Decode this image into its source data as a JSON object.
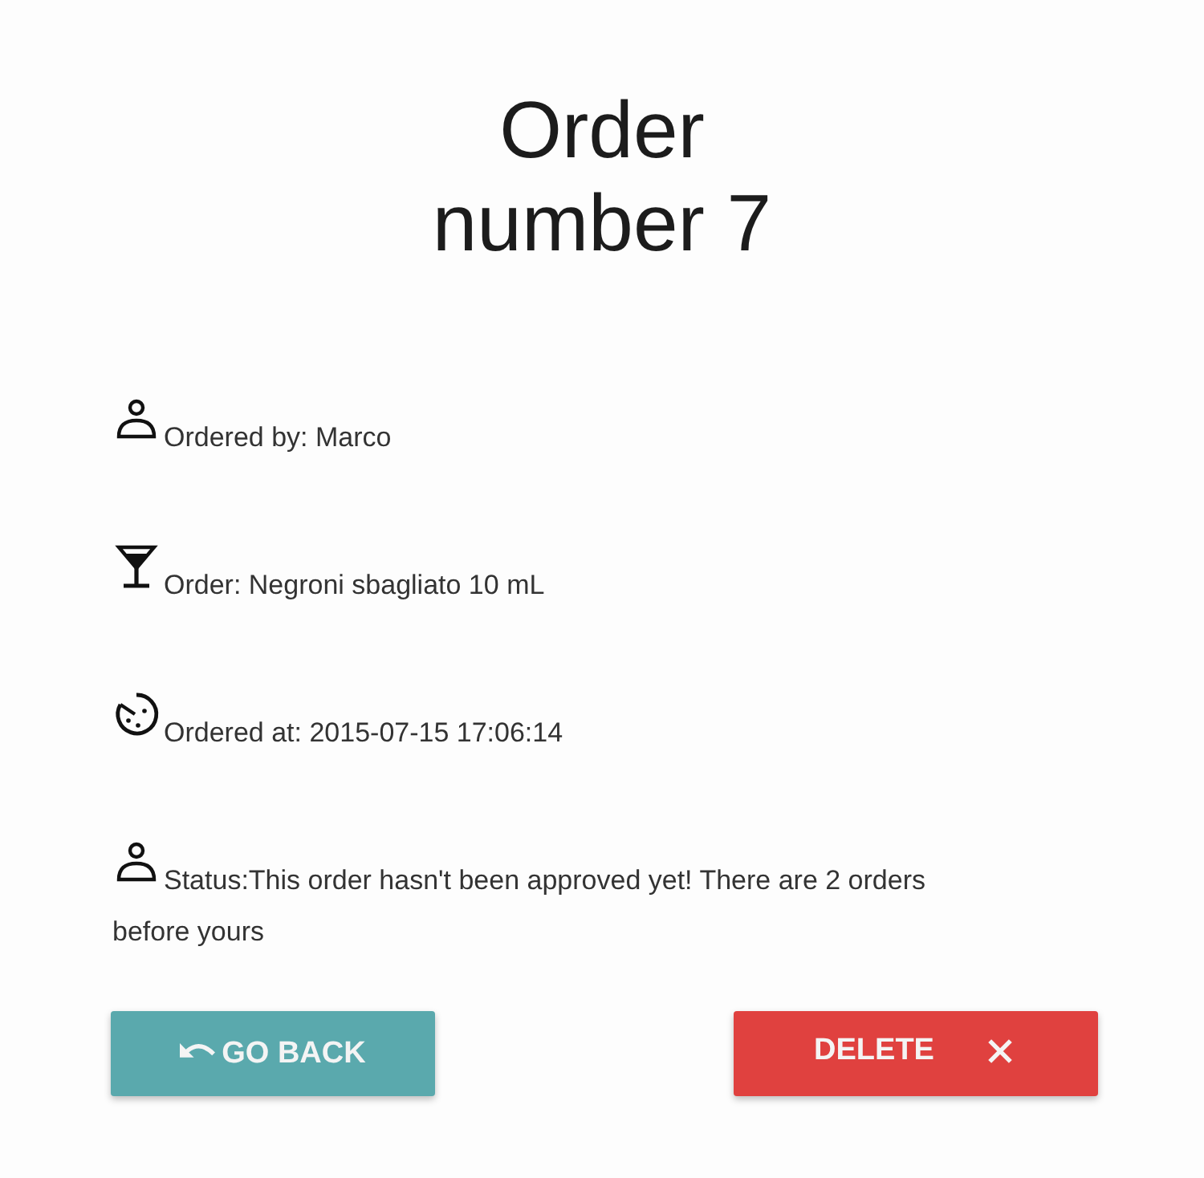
{
  "title": "Order number 7",
  "details": [
    {
      "kind": "person",
      "text": "Ordered by: Marco"
    },
    {
      "kind": "drink",
      "text": "Order: Negroni sbagliato 10 mL"
    },
    {
      "kind": "clock",
      "text": "Ordered at: 2015-07-15 17:06:14"
    },
    {
      "kind": "person",
      "text": "Status:This order hasn't been approved yet! There are 2 orders before yours"
    }
  ],
  "buttons": [
    {
      "kind": "back",
      "label": "GO BACK"
    },
    {
      "kind": "delete",
      "label": "DELETE"
    }
  ]
}
